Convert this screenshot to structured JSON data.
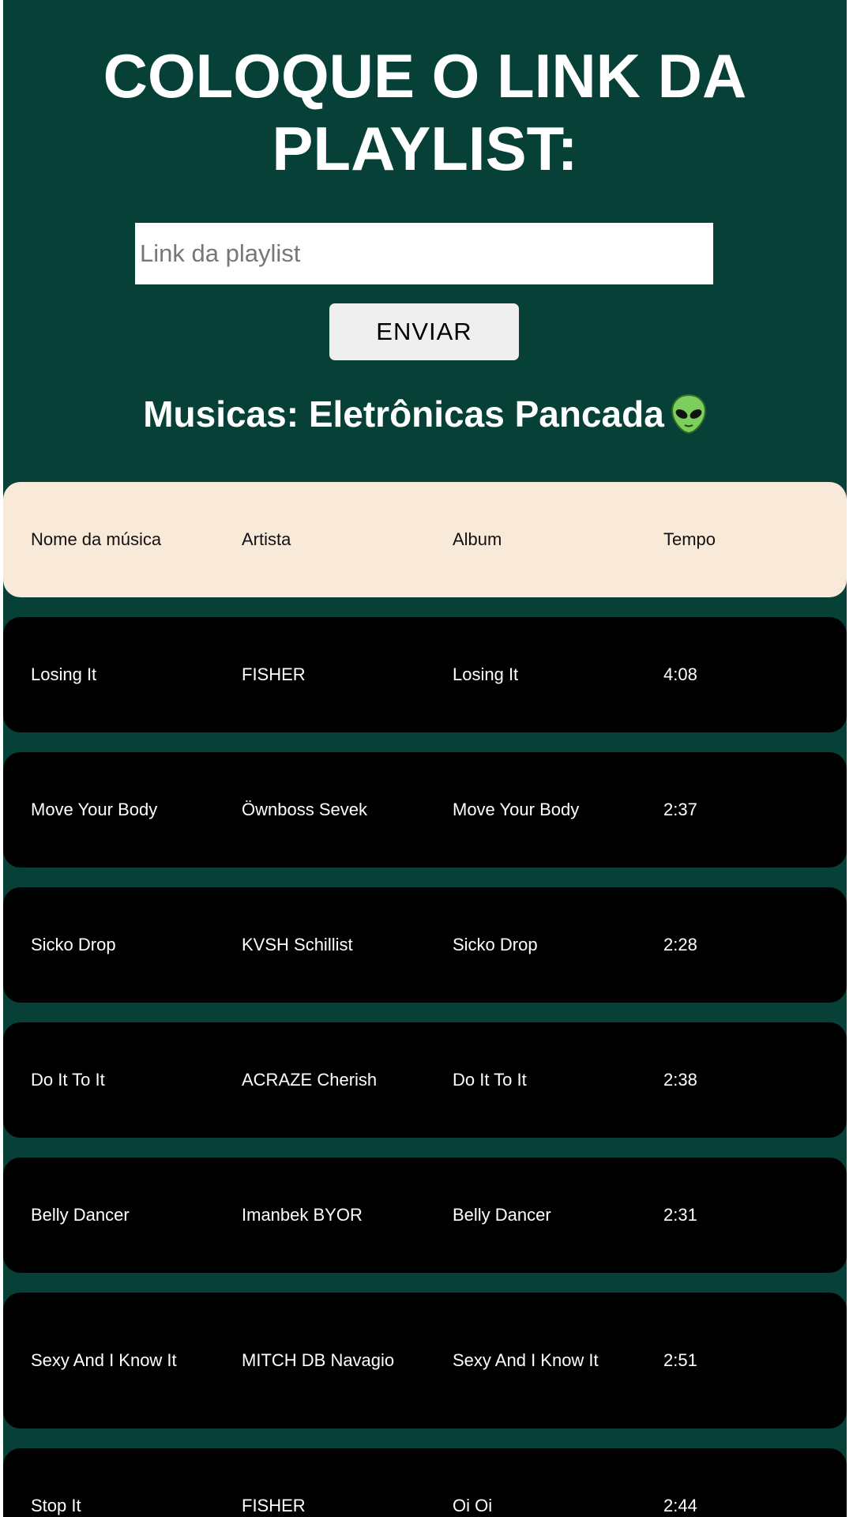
{
  "page": {
    "title": "COLOQUE O LINK DA PLAYLIST:",
    "input_placeholder": "Link da playlist",
    "submit_label": "ENVIAR",
    "playlist_heading": "Musicas: Eletrônicas Pancada",
    "heading_icon": "alien-emoji"
  },
  "table": {
    "headers": [
      "Nome da música",
      "Artista",
      "Album",
      "Tempo"
    ],
    "rows": [
      {
        "name": "Losing It",
        "artist": "FISHER",
        "album": "Losing It",
        "time": "4:08"
      },
      {
        "name": "Move Your Body",
        "artist": "Öwnboss Sevek",
        "album": "Move Your Body",
        "time": "2:37"
      },
      {
        "name": "Sicko Drop",
        "artist": "KVSH Schillist",
        "album": "Sicko Drop",
        "time": "2:28"
      },
      {
        "name": "Do It To It",
        "artist": "ACRAZE Cherish",
        "album": "Do It To It",
        "time": "2:38"
      },
      {
        "name": "Belly Dancer",
        "artist": "Imanbek BYOR",
        "album": "Belly Dancer",
        "time": "2:31"
      },
      {
        "name": "Sexy And I Know It",
        "artist": "MITCH DB Navagio",
        "album": "Sexy And I Know It",
        "time": "2:51"
      },
      {
        "name": "Stop It",
        "artist": "FISHER",
        "album": "Oi Oi",
        "time": "2:44"
      }
    ]
  },
  "colors": {
    "background": "#064037",
    "header_row": "#f9e9d8",
    "track_row": "#000000",
    "text_light": "#ffffff"
  }
}
